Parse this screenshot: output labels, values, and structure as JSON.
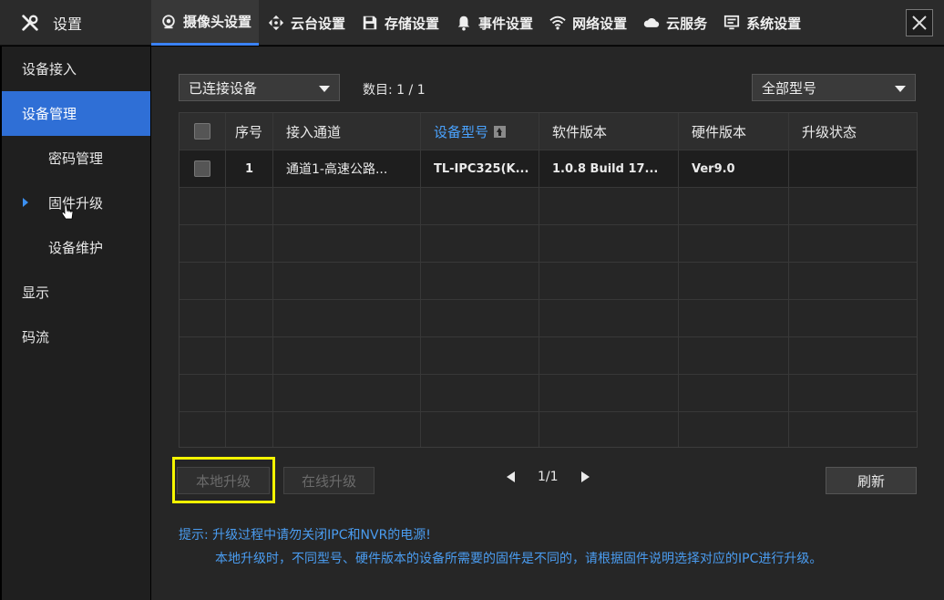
{
  "brand": {
    "title": "设置"
  },
  "tabs": [
    {
      "label": "摄像头设置",
      "icon": "camera-icon"
    },
    {
      "label": "云台设置",
      "icon": "ptz-icon"
    },
    {
      "label": "存储设置",
      "icon": "save-icon"
    },
    {
      "label": "事件设置",
      "icon": "bell-icon"
    },
    {
      "label": "网络设置",
      "icon": "wifi-icon"
    },
    {
      "label": "云服务",
      "icon": "cloud-icon"
    },
    {
      "label": "系统设置",
      "icon": "monitor-icon"
    }
  ],
  "sidebar": {
    "items": [
      {
        "label": "设备接入"
      },
      {
        "label": "设备管理"
      },
      {
        "label": "密码管理"
      },
      {
        "label": "固件升级"
      },
      {
        "label": "设备维护"
      },
      {
        "label": "显示"
      },
      {
        "label": "码流"
      }
    ]
  },
  "filters": {
    "device_select": "已连接设备",
    "count_label": "数目: 1 / 1",
    "model_select": "全部型号"
  },
  "table": {
    "columns": [
      "序号",
      "接入通道",
      "设备型号",
      "软件版本",
      "硬件版本",
      "升级状态"
    ],
    "rows": [
      {
        "index": "1",
        "channel": "通道1-高速公路...",
        "model": "TL-IPC325(K...",
        "software": "1.0.8 Build 17...",
        "hardware": "Ver9.0",
        "status": ""
      }
    ]
  },
  "actions": {
    "local_upgrade": "本地升级",
    "online_upgrade": "在线升级",
    "page": "1/1",
    "refresh": "刷新"
  },
  "hints": {
    "line1": "提示: 升级过程中请勿关闭IPC和NVR的电源!",
    "line2": "本地升级时，不同型号、硬件版本的设备所需要的固件是不同的，请根据固件说明选择对应的IPC进行升级。"
  },
  "colors": {
    "accent": "#2f6fd6",
    "highlight": "#f5f500",
    "hint": "#4a9cf0"
  }
}
